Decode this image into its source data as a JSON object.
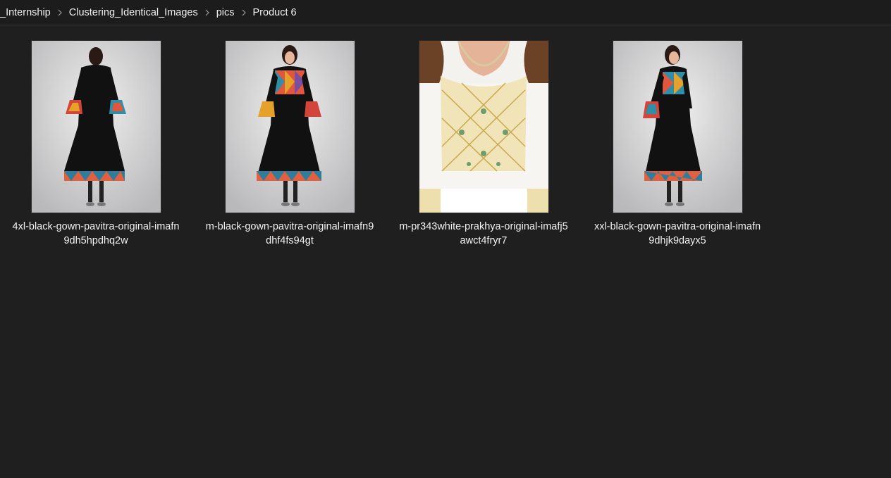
{
  "breadcrumb": {
    "items": [
      "_Internship",
      "Clustering_Identical_Images",
      "pics",
      "Product 6"
    ]
  },
  "files": [
    {
      "line1": "4xl-black-gown-pavitra-original-imafn",
      "line2": "9dh5hpdhq2w"
    },
    {
      "line1": "m-black-gown-pavitra-original-imafn9",
      "line2": "dhf4fs94gt"
    },
    {
      "line1": "m-pr343white-prakhya-original-imafj5",
      "line2": "awct4fryr7"
    },
    {
      "line1": "xxl-black-gown-pavitra-original-imafn",
      "line2": "9dhjk9dayx5"
    }
  ],
  "colors": {
    "background": "#1f1f1f",
    "topbar": "#1c1c1c",
    "text": "#f0f0f0"
  },
  "icons": {
    "separator": "chevron-right-icon"
  }
}
